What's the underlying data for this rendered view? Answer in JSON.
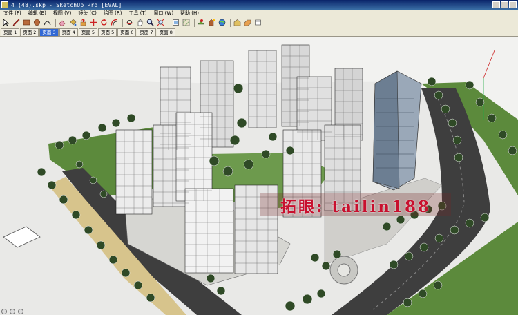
{
  "window": {
    "title": "4 (48).skp - SketchUp Pro [EVAL]"
  },
  "menu": [
    "文件 (F)",
    "编辑 (E)",
    "视图 (V)",
    "镜头 (C)",
    "绘图 (R)",
    "工具 (T)",
    "窗口 (W)",
    "帮助 (H)"
  ],
  "tabs": [
    "页面 1",
    "页面 2",
    "页面 3",
    "页面 4",
    "页面 5",
    "页面 5",
    "页面 6",
    "页面 7",
    "页面 8"
  ],
  "active_tab_index": 2,
  "watermark_text": "拓眼: tailin188",
  "icons": [
    "select-icon",
    "pencil-icon",
    "rectangle-icon",
    "circle-icon",
    "arc-icon",
    "eraser-icon",
    "paint-bucket-icon",
    "push-pull-icon",
    "move-icon",
    "rotate-icon",
    "offset-icon",
    "tape-measure-icon",
    "orbit-icon",
    "pan-icon",
    "zoom-icon",
    "zoom-extents-icon",
    "components-icon",
    "materials-icon",
    "section-icon",
    "shadow-icon",
    "geo-location-icon",
    "warehouse-icon",
    "extension-icon",
    "layout-icon"
  ]
}
